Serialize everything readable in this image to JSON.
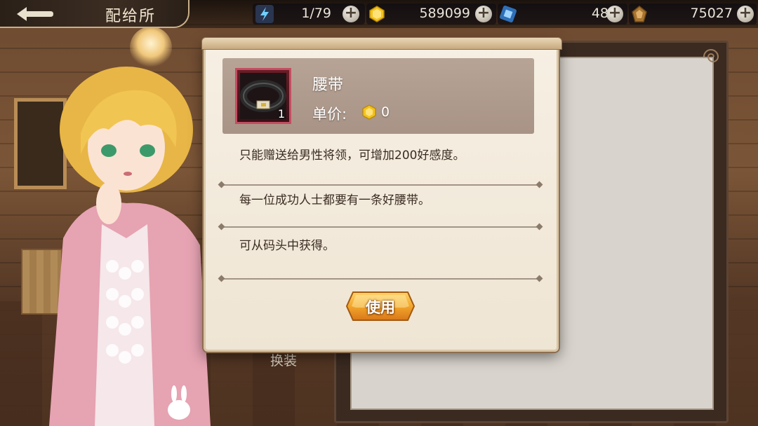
{
  "header": {
    "title": "配给所"
  },
  "resources": [
    {
      "name": "stamina",
      "icon": "lightning-icon",
      "value": "1/79"
    },
    {
      "name": "gold",
      "icon": "gold-coin-icon",
      "value": "589099"
    },
    {
      "name": "gem",
      "icon": "blue-gem-icon",
      "value": "48"
    },
    {
      "name": "token",
      "icon": "bronze-token-icon",
      "value": "75027"
    }
  ],
  "side_label": "换装",
  "item": {
    "name": "腰带",
    "count": "1",
    "price_label": "单价:",
    "price_value": "0",
    "descriptions": [
      "只能赠送给男性将领，可增加200好感度。",
      "每一位成功人士都要有一条好腰带。",
      "可从码头中获得。"
    ]
  },
  "actions": {
    "use_label": "使用"
  },
  "colors": {
    "accent_button": "#f2a62b",
    "slot_border": "#c34e62",
    "dialog_bg": "#f3eadb"
  }
}
